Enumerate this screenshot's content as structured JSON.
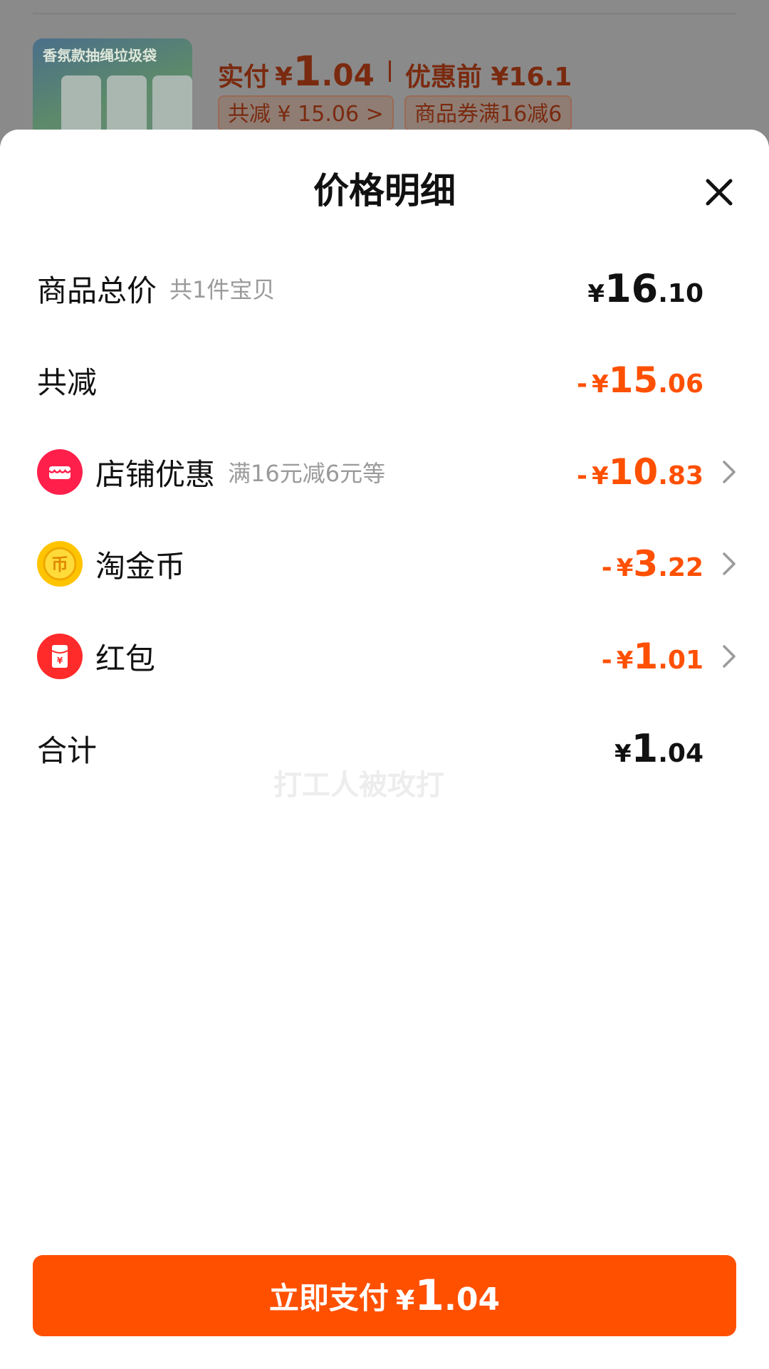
{
  "background": {
    "actual_pay_label": "实付",
    "currency": "¥",
    "actual_pay_int": "1",
    "actual_pay_dec": ".04",
    "before_discount": "优惠前 ¥16.1",
    "total_discount_tag": "共减 ¥ 15.06 >",
    "coupon_tag": "商品券满16减6",
    "product_image_text": "香氛款抽绳垃圾袋"
  },
  "sheet": {
    "title": "价格明细",
    "rows": [
      {
        "label": "商品总价",
        "sub": "共1件宝贝",
        "neg": "",
        "currency": "¥",
        "int": "16",
        "dec": ".10"
      },
      {
        "label": "共减",
        "sub": "",
        "neg": "-",
        "currency": "¥",
        "int": "15",
        "dec": ".06"
      },
      {
        "label": "店铺优惠",
        "sub": "满16元减6元等",
        "neg": "-",
        "currency": "¥",
        "int": "10",
        "dec": ".83",
        "icon": "store-icon"
      },
      {
        "label": "淘金币",
        "sub": "",
        "neg": "-",
        "currency": "¥",
        "int": "3",
        "dec": ".22",
        "icon": "gold-coin-icon"
      },
      {
        "label": "红包",
        "sub": "",
        "neg": "-",
        "currency": "¥",
        "int": "1",
        "dec": ".01",
        "icon": "red-envelope-icon"
      },
      {
        "label": "合计",
        "sub": "",
        "neg": "",
        "currency": "¥",
        "int": "1",
        "dec": ".04"
      }
    ],
    "watermark": "打工人被攻打"
  },
  "pay_button": {
    "label": "立即支付",
    "currency": "¥",
    "int": "1",
    "dec": ".04"
  },
  "colors": {
    "accent": "#ff5000",
    "text": "#111111",
    "muted": "#9a9a9a"
  }
}
